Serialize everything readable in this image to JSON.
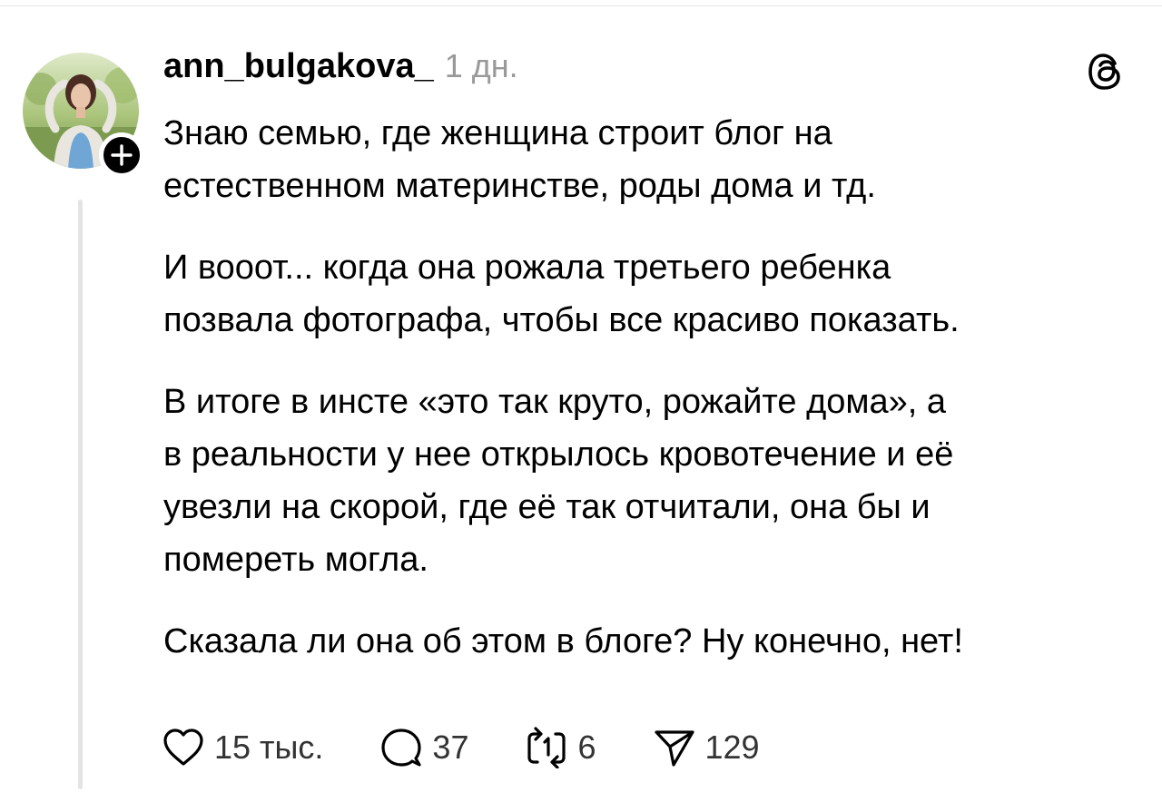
{
  "post": {
    "username": "ann_bulgakova_",
    "timestamp": "1 дн.",
    "paragraphs": [
      "Знаю семью, где женщина строит блог на\nестественном материнстве, роды дома и тд.",
      "И вооот... когда она рожала третьего ребенка\nпозвала фотографа, чтобы все красиво показать.",
      "В итоге в инсте «это так круто, рожайте дома», а\nв реальности у нее открылось кровотечение и её\nувезли на скорой, где её так отчитали, она бы и\nпомереть могла.",
      "Сказала ли она об этом в блоге? Ну конечно, нет!"
    ],
    "actions": {
      "likes": "15 тыс.",
      "replies": "37",
      "reposts": "6",
      "shares": "129"
    }
  },
  "icons": {
    "like": "heart-icon",
    "reply": "speech-bubble-icon",
    "repost": "repost-icon",
    "share": "send-icon",
    "app": "threads-logo-icon",
    "follow": "plus-icon"
  },
  "colors": {
    "text": "#000000",
    "muted": "#999999",
    "thread_line": "#e4e4e4"
  }
}
